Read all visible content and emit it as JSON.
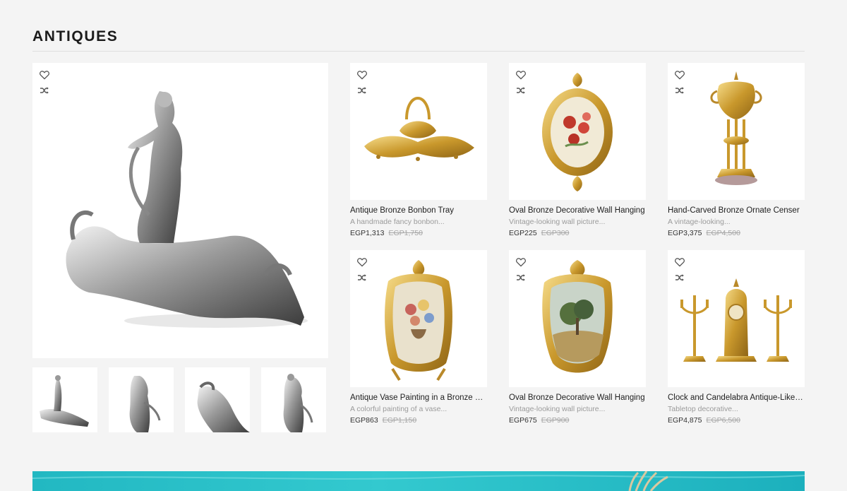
{
  "section": {
    "title": "ANTIQUES"
  },
  "icons": {
    "wishlist": "heart-icon",
    "compare": "shuffle-icon"
  },
  "featured": {
    "thumbnails": [
      {
        "alt": "thumbnail-1"
      },
      {
        "alt": "thumbnail-2"
      },
      {
        "alt": "thumbnail-3"
      },
      {
        "alt": "thumbnail-4"
      }
    ]
  },
  "products": [
    {
      "name": "Antique Bronze Bonbon Tray",
      "desc": "A handmade fancy bonbon...",
      "price": "EGP1,313",
      "old_price": "EGP1,750"
    },
    {
      "name": "Oval Bronze Decorative Wall Hanging",
      "desc": "Vintage-looking wall picture...",
      "price": "EGP225",
      "old_price": "EGP300"
    },
    {
      "name": "Hand-Carved Bronze Ornate Censer",
      "desc": "A vintage-looking...",
      "price": "EGP3,375",
      "old_price": "EGP4,500"
    },
    {
      "name": "Antique Vase Painting in a Bronze Frame",
      "desc": "A colorful painting of a vase...",
      "price": "EGP863",
      "old_price": "EGP1,150"
    },
    {
      "name": "Oval Bronze Decorative Wall Hanging",
      "desc": "Vintage-looking wall picture...",
      "price": "EGP675",
      "old_price": "EGP900"
    },
    {
      "name": "Clock and Candelabra Antique-Like Set",
      "desc": "Tabletop decorative...",
      "price": "EGP4,875",
      "old_price": "EGP6,500"
    }
  ]
}
